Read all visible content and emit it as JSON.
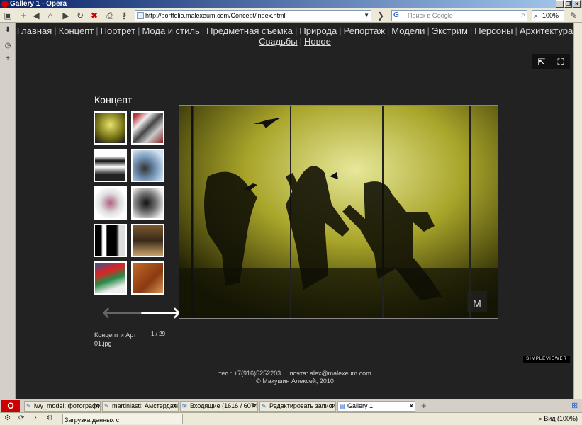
{
  "window": {
    "title": "Gallery 1 - Opera"
  },
  "toolbar": {
    "url": "http://portfolio.malexeum.com/Concept/index.html",
    "search_placeholder": "Поиск в Google",
    "zoom": "100%"
  },
  "nav": {
    "line1": [
      "Главная",
      "Концепт",
      "Портрет",
      "Мода и стиль",
      "Предметная съемка",
      "Природа",
      "Репортаж",
      "Модели",
      "Экстрим",
      "Персоны",
      "Архитектура"
    ],
    "line2": [
      "Свадьбы",
      "Новое"
    ]
  },
  "gallery": {
    "title": "Концепт",
    "caption": "Концепт и Арт 01.jpg",
    "counter": "1 / 29",
    "viewer_logo": "SIMPLEVIEWER"
  },
  "footer": {
    "phone": "тел.: +7(916)5252203",
    "email": "почта: alex@malexeum.com",
    "copyright": "© Макушин Алексей, 2010"
  },
  "tabs": [
    "iwy_model: фотографи...",
    "martiniasti: Амстердам...",
    "Входящие (1616 / 6074...",
    "Редактировать записи",
    "Gallery 1"
  ],
  "status": {
    "text": "Загрузка данных с portfolio.malexeum.com",
    "zoom": "Вид (100%)"
  }
}
